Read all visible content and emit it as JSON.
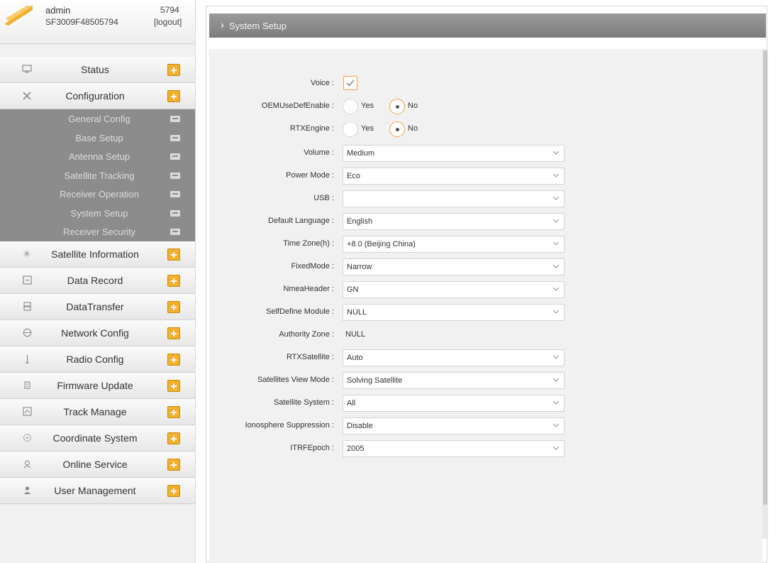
{
  "user": {
    "name": "admin",
    "serial": "SF3009F48505794",
    "code": "5794",
    "logout": "[logout]"
  },
  "menu": {
    "status": "Status",
    "configuration": "Configuration",
    "config_sub": [
      "General Config",
      "Base Setup",
      "Antenna Setup",
      "Satellite Tracking",
      "Receiver Operation",
      "System Setup",
      "Receiver Security"
    ],
    "lower": [
      {
        "label": "Satellite Information",
        "icon": "satellite-icon"
      },
      {
        "label": "Data Record",
        "icon": "record-icon"
      },
      {
        "label": "DataTransfer",
        "icon": "transfer-icon"
      },
      {
        "label": "Network Config",
        "icon": "globe-icon"
      },
      {
        "label": "Radio Config",
        "icon": "radio-antenna-icon"
      },
      {
        "label": "Firmware Update",
        "icon": "firmware-icon"
      },
      {
        "label": "Track Manage",
        "icon": "track-icon"
      },
      {
        "label": "Coordinate System",
        "icon": "coordinate-icon"
      },
      {
        "label": "Online Service",
        "icon": "service-icon"
      },
      {
        "label": "User Management",
        "icon": "user-icon"
      }
    ]
  },
  "panel": {
    "title": "System Setup"
  },
  "form": {
    "voice_label": "Voice :",
    "oem_label": "OEMUseDefEnable :",
    "rtx_engine_label": "RTXEngine :",
    "yes": "Yes",
    "no": "No",
    "volume": {
      "label": "Volume :",
      "value": "Medium"
    },
    "power_mode": {
      "label": "Power Mode :",
      "value": "Eco"
    },
    "usb": {
      "label": "USB :",
      "value": ""
    },
    "default_language": {
      "label": "Default Language :",
      "value": "English"
    },
    "time_zone": {
      "label": "Time Zone(h) :",
      "value": "+8.0 (Beijing China)"
    },
    "fixed_mode": {
      "label": "FixedMode :",
      "value": "Narrow"
    },
    "nmea_header": {
      "label": "NmeaHeader :",
      "value": "GN"
    },
    "self_define_module": {
      "label": "SelfDefine Module :",
      "value": "NULL"
    },
    "authority_zone": {
      "label": "Authority Zone :",
      "value": "NULL"
    },
    "rtx_satellite": {
      "label": "RTXSatellite :",
      "value": "Auto"
    },
    "satellites_view_mode": {
      "label": "Satellites View Mode :",
      "value": "Solving Satellite"
    },
    "satellite_system": {
      "label": "Satellite System :",
      "value": "All"
    },
    "ionosphere_suppression": {
      "label": "Ionosphere Suppression :",
      "value": "Disable"
    },
    "itrf_epoch": {
      "label": "ITRFEpoch :",
      "value": "2005"
    }
  },
  "colors": {
    "accent": "#f0b030",
    "submenu_bg": "#8c8c8c",
    "header_bg": "#8a8a8a"
  }
}
